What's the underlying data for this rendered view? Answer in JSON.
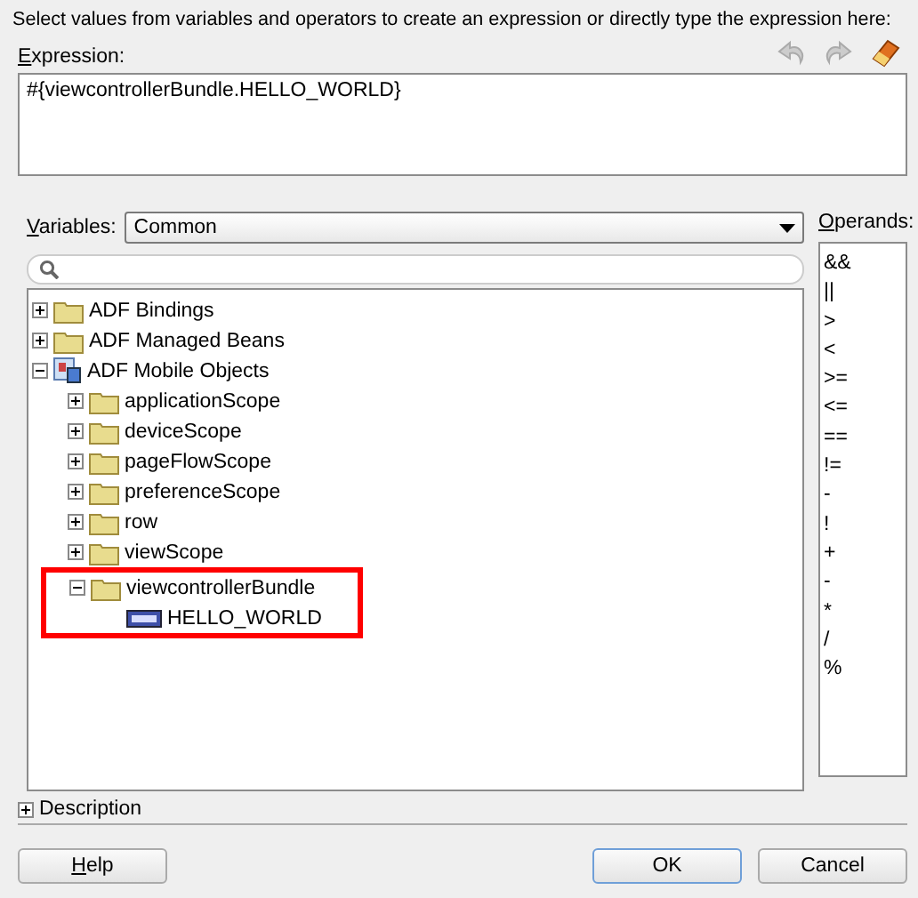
{
  "instructions": "Select values from variables and operators to create an expression or directly type the expression here:",
  "expression": {
    "label": "Expression:",
    "value": "#{viewcontrollerBundle.HELLO_WORLD}"
  },
  "variables": {
    "label": "Variables:",
    "value": "Common"
  },
  "tree": [
    {
      "label": "ADF Bindings",
      "kind": "folder",
      "expanded": false,
      "highlighted": false
    },
    {
      "label": "ADF Managed Beans",
      "kind": "folder",
      "expanded": false,
      "highlighted": false
    },
    {
      "label": "ADF Mobile Objects",
      "kind": "objects",
      "expanded": true,
      "highlighted": false,
      "children": [
        {
          "label": "applicationScope",
          "kind": "folder",
          "expanded": false,
          "highlighted": false
        },
        {
          "label": "deviceScope",
          "kind": "folder",
          "expanded": false,
          "highlighted": false
        },
        {
          "label": "pageFlowScope",
          "kind": "folder",
          "expanded": false,
          "highlighted": false
        },
        {
          "label": "preferenceScope",
          "kind": "folder",
          "expanded": false,
          "highlighted": false
        },
        {
          "label": "row",
          "kind": "folder",
          "expanded": false,
          "highlighted": false
        },
        {
          "label": "viewScope",
          "kind": "folder",
          "expanded": false,
          "highlighted": false
        },
        {
          "label": "viewcontrollerBundle",
          "kind": "folder",
          "expanded": true,
          "highlighted": true,
          "children": [
            {
              "label": "HELLO_WORLD",
              "kind": "value",
              "highlighted": false
            }
          ]
        }
      ]
    }
  ],
  "operands": {
    "label": "Operands:",
    "items": [
      "&&",
      "||",
      ">",
      "<",
      ">=",
      "<=",
      "==",
      "!=",
      "-",
      "!",
      "+",
      "-",
      "*",
      "/",
      "%"
    ]
  },
  "description": {
    "label": "Description",
    "expanded": false
  },
  "buttons": [
    {
      "label": "Help",
      "kind": "help",
      "default": false
    },
    {
      "label": "OK",
      "kind": "ok",
      "default": true
    },
    {
      "label": "Cancel",
      "kind": "cancel",
      "default": false
    }
  ]
}
